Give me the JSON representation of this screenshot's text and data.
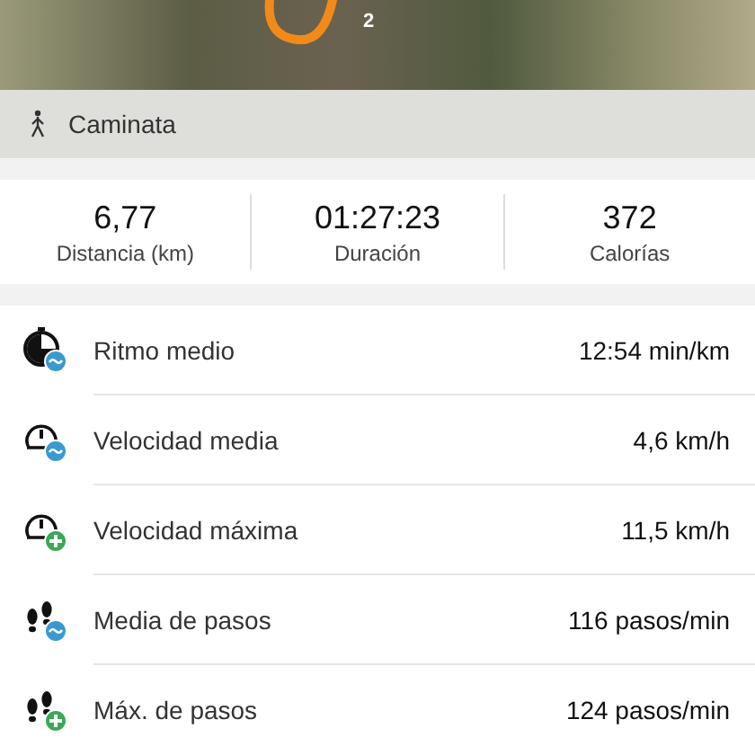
{
  "map": {
    "marker_label": "2"
  },
  "activity": {
    "label": "Caminata"
  },
  "stats": [
    {
      "value": "6,77",
      "label": "Distancia (km)"
    },
    {
      "value": "01:27:23",
      "label": "Duración"
    },
    {
      "value": "372",
      "label": "Calorías"
    }
  ],
  "metrics": [
    {
      "kind": "pace",
      "badge": {
        "kind": "average"
      },
      "label": "Ritmo medio",
      "value": "12:54 min/km"
    },
    {
      "kind": "speed",
      "badge": {
        "kind": "average"
      },
      "label": "Velocidad media",
      "value": "4,6 km/h"
    },
    {
      "kind": "speed",
      "badge": {
        "kind": "maximum"
      },
      "label": "Velocidad máxima",
      "value": "11,5 km/h"
    },
    {
      "kind": "steps",
      "badge": {
        "kind": "average"
      },
      "label": "Media de pasos",
      "value": "116 pasos/min"
    },
    {
      "kind": "steps",
      "badge": {
        "kind": "maximum"
      },
      "label": "Máx. de pasos",
      "value": "124 pasos/min"
    }
  ]
}
